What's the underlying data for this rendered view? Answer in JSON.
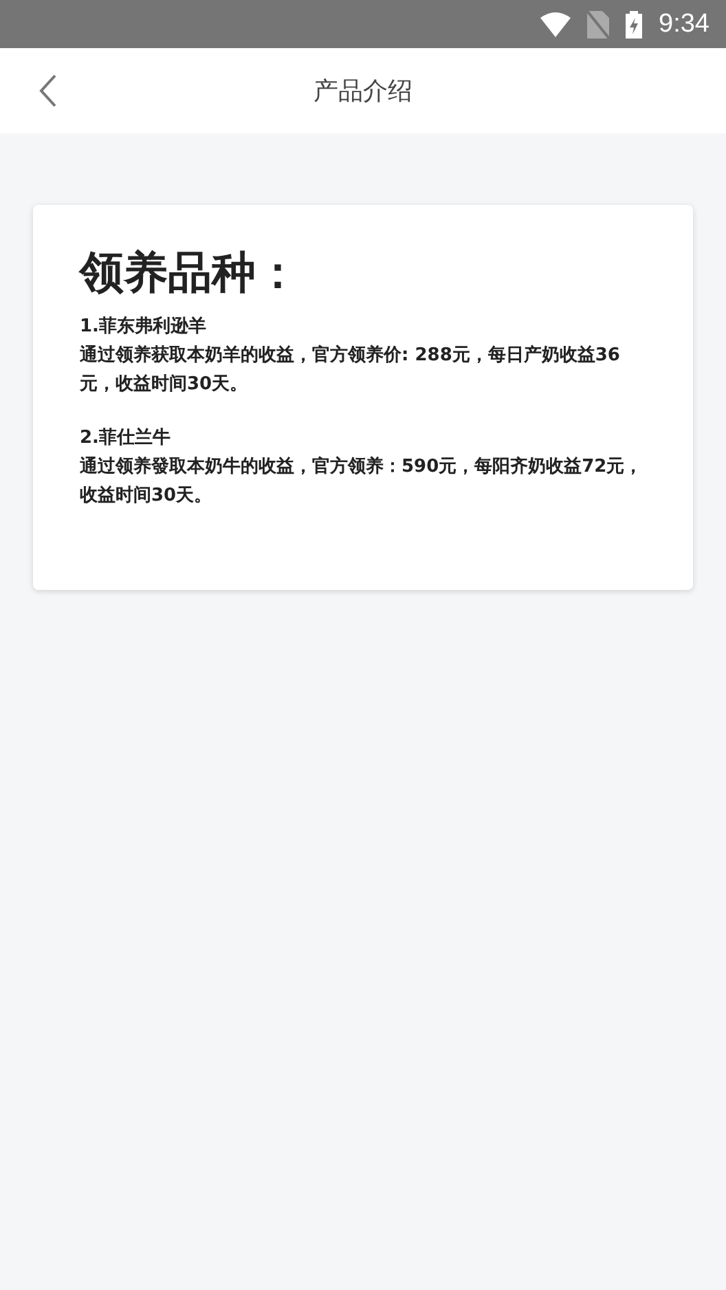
{
  "status_bar": {
    "time": "9:34"
  },
  "header": {
    "title": "产品介绍"
  },
  "card": {
    "heading": "领养品种：",
    "items": [
      {
        "name": "1.菲东弗利逊羊",
        "description": "通过领养获取本奶羊的收益，官方领养价: 288元，每日产奶收益36元，收益时间30天。"
      },
      {
        "name": "2.菲仕兰牛",
        "description": "通过领养發取本奶牛的收益，官方领养：590元，每阳齐奶收益72元，收益时间30天。"
      }
    ]
  }
}
